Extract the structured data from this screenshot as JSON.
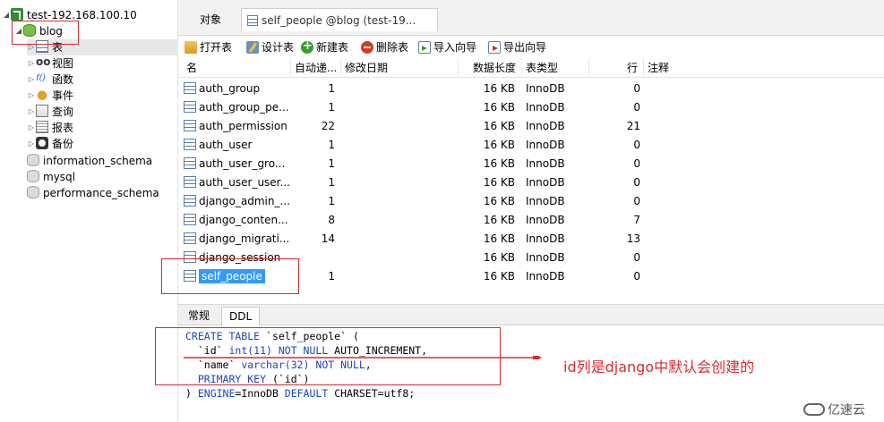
{
  "sidebar": {
    "connection": "test-192.168.100.10",
    "database": "blog",
    "folders": [
      "表",
      "视图",
      "函数",
      "事件",
      "查询",
      "报表",
      "备份"
    ],
    "other_dbs": [
      "information_schema",
      "mysql",
      "performance_schema"
    ]
  },
  "tabs": {
    "objects": "对象",
    "table_tab": "self_people @blog (test-19..."
  },
  "toolbar": {
    "open": "打开表",
    "design": "设计表",
    "new": "新建表",
    "delete": "删除表",
    "import": "导入向导",
    "export": "导出向导"
  },
  "grid": {
    "headers": [
      "名",
      "自动递...",
      "修改日期",
      "数据长度",
      "表类型",
      "行",
      "注释"
    ],
    "rows": [
      {
        "name": "auth_group",
        "auto_inc": "1",
        "modified": "",
        "data_len": "16 KB",
        "engine": "InnoDB",
        "rows": "0"
      },
      {
        "name": "auth_group_pe...",
        "auto_inc": "1",
        "modified": "",
        "data_len": "16 KB",
        "engine": "InnoDB",
        "rows": "0"
      },
      {
        "name": "auth_permission",
        "auto_inc": "22",
        "modified": "",
        "data_len": "16 KB",
        "engine": "InnoDB",
        "rows": "21"
      },
      {
        "name": "auth_user",
        "auto_inc": "1",
        "modified": "",
        "data_len": "16 KB",
        "engine": "InnoDB",
        "rows": "0"
      },
      {
        "name": "auth_user_gro...",
        "auto_inc": "1",
        "modified": "",
        "data_len": "16 KB",
        "engine": "InnoDB",
        "rows": "0"
      },
      {
        "name": "auth_user_user...",
        "auto_inc": "1",
        "modified": "",
        "data_len": "16 KB",
        "engine": "InnoDB",
        "rows": "0"
      },
      {
        "name": "django_admin_...",
        "auto_inc": "1",
        "modified": "",
        "data_len": "16 KB",
        "engine": "InnoDB",
        "rows": "0"
      },
      {
        "name": "django_conten...",
        "auto_inc": "8",
        "modified": "",
        "data_len": "16 KB",
        "engine": "InnoDB",
        "rows": "7"
      },
      {
        "name": "django_migrati...",
        "auto_inc": "14",
        "modified": "",
        "data_len": "16 KB",
        "engine": "InnoDB",
        "rows": "13"
      },
      {
        "name": "django_session",
        "auto_inc": "",
        "modified": "",
        "data_len": "16 KB",
        "engine": "InnoDB",
        "rows": "0"
      },
      {
        "name": "self_people",
        "auto_inc": "1",
        "modified": "",
        "data_len": "16 KB",
        "engine": "InnoDB",
        "rows": "0"
      }
    ]
  },
  "bottom_tabs": [
    "常规",
    "DDL"
  ],
  "ddl": {
    "l1_kw": "CREATE TABLE",
    "l1_rest": " `self_people` (",
    "l2_field": "  `id` ",
    "l2_type": "int(11)",
    "l2_nn": " NOT NULL",
    "l2_rest": " AUTO_INCREMENT,",
    "l3_field": "  `name` ",
    "l3_type": "varchar(32)",
    "l3_nn": " NOT NULL",
    "l3_rest": ",",
    "l4_kw": "  PRIMARY KEY",
    "l4_rest": " (`id`)",
    "l5_pre": ") ",
    "l5_kw1": "ENGINE",
    "l5_mid1": "=InnoDB ",
    "l5_kw2": "DEFAULT",
    "l5_mid2": " CHARSET=utf8;"
  },
  "annotation": {
    "text": "id列是django中默认会创建的",
    "color": "#e0282c"
  },
  "watermark": "亿速云"
}
